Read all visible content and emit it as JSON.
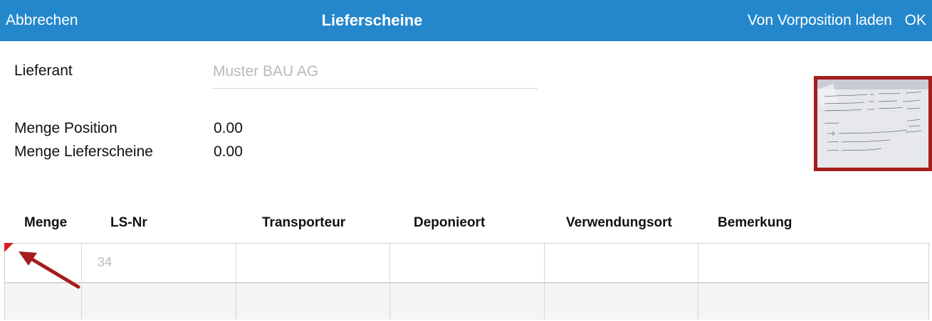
{
  "navbar": {
    "cancel_label": "Abbrechen",
    "title": "Lieferscheine",
    "load_label": "Von Vorposition laden",
    "ok_label": "OK"
  },
  "form": {
    "supplier_label": "Lieferant",
    "supplier_placeholder": "Muster BAU AG",
    "qty_position_label": "Menge Position",
    "qty_position_value": "0.00",
    "qty_notes_label": "Menge Lieferscheine",
    "qty_notes_value": "0.00"
  },
  "table": {
    "headers": [
      "Menge",
      "LS-Nr",
      "Transporteur",
      "Deponieort",
      "Verwendungsort",
      "Bemerkung"
    ],
    "rows": [
      {
        "ls_nr_placeholder": "34"
      },
      {
        "ls_nr_placeholder": ""
      }
    ]
  },
  "colors": {
    "navbar": "#2487cc",
    "thumbnail_border": "#a51d1d",
    "arrow": "#a51d1d",
    "corner_mark": "#d81b1b"
  }
}
